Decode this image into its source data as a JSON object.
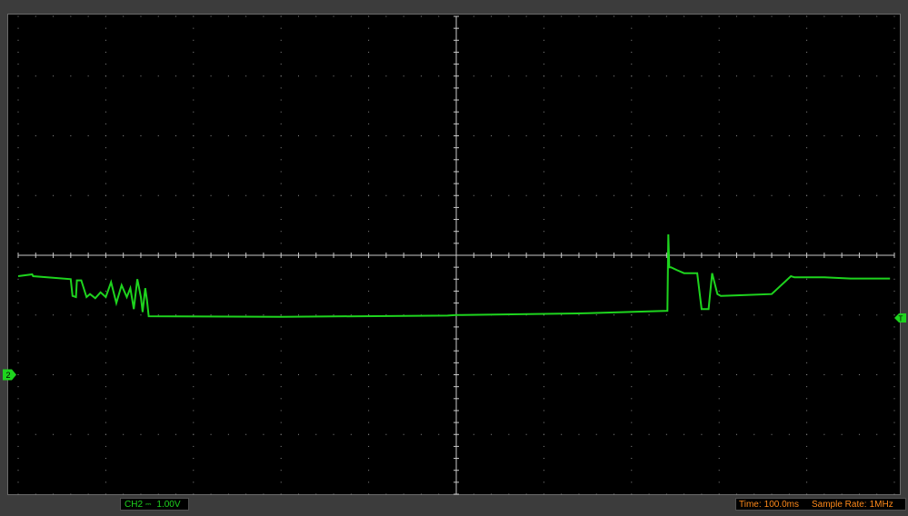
{
  "chart_data": {
    "type": "line",
    "title": "",
    "xlabel": "",
    "ylabel": "",
    "grid": true,
    "divisions": {
      "x": 10,
      "y": 8
    },
    "xlim": [
      0,
      10
    ],
    "ylim": [
      -4,
      4
    ],
    "series": [
      {
        "color": "#1ed41e",
        "x": [
          0,
          0.16,
          0.17,
          0.6,
          0.62,
          0.66,
          0.67,
          0.72,
          0.78,
          0.82,
          0.88,
          0.94,
          1.0,
          1.06,
          1.12,
          1.18,
          1.24,
          1.28,
          1.32,
          1.36,
          1.4,
          1.42,
          1.45,
          1.47,
          1.49,
          3.0,
          4.9,
          5.0,
          6.5,
          7.41,
          7.42,
          7.43,
          7.45,
          7.52,
          7.6,
          7.75,
          7.8,
          7.88,
          7.92,
          7.98,
          8.02,
          8.2,
          8.6,
          8.82,
          8.86,
          9.2,
          9.5,
          9.95
        ],
        "y": [
          -0.35,
          -0.32,
          -0.35,
          -0.4,
          -0.68,
          -0.7,
          -0.42,
          -0.42,
          -0.7,
          -0.65,
          -0.72,
          -0.62,
          -0.7,
          -0.45,
          -0.8,
          -0.5,
          -0.7,
          -0.55,
          -0.9,
          -0.4,
          -0.7,
          -0.95,
          -0.55,
          -0.75,
          -1.02,
          -1.03,
          -1.01,
          -1.0,
          -0.97,
          -0.93,
          0.35,
          -0.2,
          -0.2,
          -0.25,
          -0.3,
          -0.3,
          -0.9,
          -0.9,
          -0.3,
          -0.65,
          -0.68,
          -0.67,
          -0.65,
          -0.35,
          -0.37,
          -0.37,
          -0.39,
          -0.39
        ]
      }
    ],
    "markers": {
      "channel_ground": "2",
      "trigger": "T"
    }
  },
  "status": {
    "channel": "CH2",
    "coupling": "⎓",
    "volts_div": "1.00V",
    "time_label": "Time:",
    "time_value": "100.0ms",
    "rate_label": "Sample Rate:",
    "rate_value": "1MHz"
  },
  "colors": {
    "background": "#3c3c3c",
    "screen": "#000000",
    "grid": "#8a8a8a",
    "trace": "#1ed41e",
    "channel_text": "#1ed41e",
    "timebase_text": "#ff8a1a"
  }
}
